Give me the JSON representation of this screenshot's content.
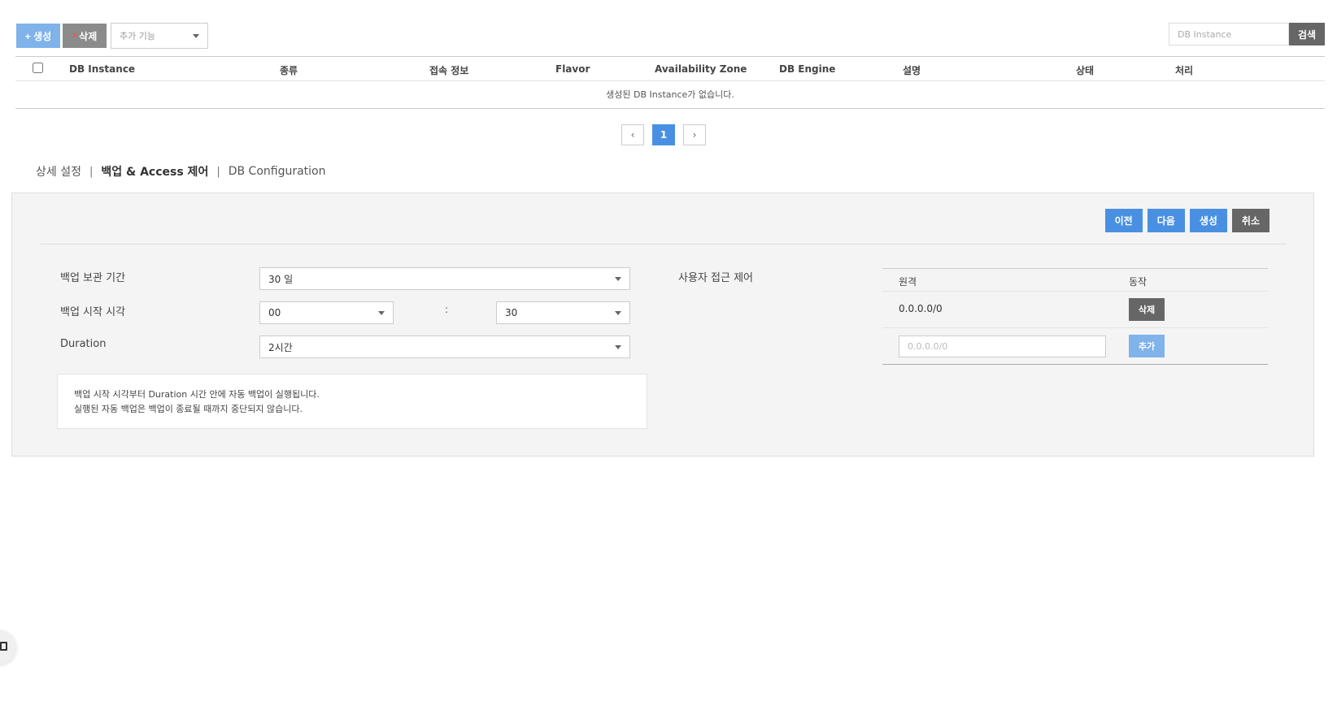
{
  "toolbar": {
    "create_label": "+ 생성",
    "delete_x": "×",
    "delete_label": "삭제",
    "extra_placeholder": "추가 기능"
  },
  "search": {
    "placeholder": "DB Instance",
    "button_label": "검색"
  },
  "grid": {
    "columns": [
      "DB Instance",
      "종류",
      "접속 정보",
      "Flavor",
      "Availability Zone",
      "DB Engine",
      "설명",
      "상태",
      "처리"
    ],
    "empty_message": "생성된 DB Instance가 없습니다."
  },
  "pagination": {
    "prev": "‹",
    "current": "1",
    "next": "›"
  },
  "tabs": [
    {
      "label": "상세 설정",
      "active": false
    },
    {
      "label": "백업 & Access 제어",
      "active": true
    },
    {
      "label": "DB Configuration",
      "active": false
    }
  ],
  "tab_separator": "|",
  "panel": {
    "actions": {
      "prev": "이전",
      "next": "다음",
      "create": "생성",
      "cancel": "취소"
    },
    "backup_retention": {
      "label": "백업 보관 기간",
      "value": "30 일"
    },
    "backup_start": {
      "label": "백업 시작 시각",
      "hour": "00",
      "separator": ":",
      "minute": "30"
    },
    "duration": {
      "label": "Duration",
      "value": "2시간"
    },
    "note": {
      "line1": "백업 시작 시각부터 Duration 시간 안에 자동 백업이 실행됩니다.",
      "line2": "실행된 자동 백업은 백업이 종료될 때까지 중단되지 않습니다."
    },
    "access_control": {
      "label": "사용자 접근 제어",
      "col_remote": "원격",
      "col_action": "동작",
      "rows": [
        {
          "remote": "0.0.0.0/0",
          "action": "삭제"
        }
      ],
      "add_placeholder": "0.0.0.0/0",
      "add_label": "추가"
    }
  },
  "colors": {
    "primary": "#4a90e2",
    "light_primary": "#7fb3ea",
    "dark": "#666666",
    "panel_bg": "#f4f4f4"
  }
}
